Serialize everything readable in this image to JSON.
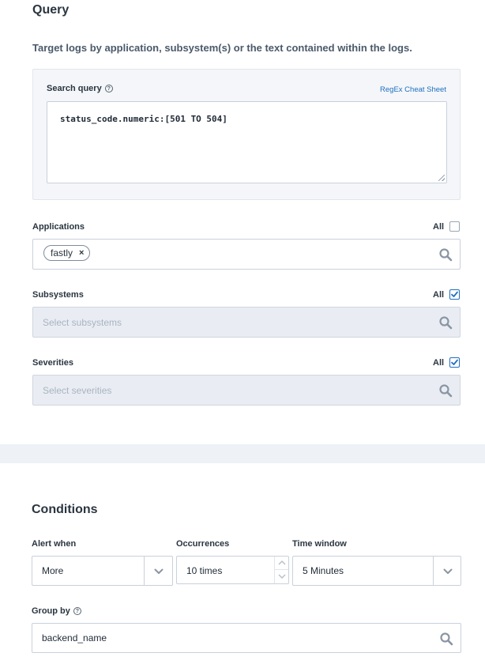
{
  "query": {
    "title": "Query",
    "description": "Target logs by application, subsystem(s) or the text contained within the logs.",
    "search_query_label": "Search query",
    "regex_link": "RegEx Cheat Sheet",
    "search_query_value": "status_code.numeric:[501 TO 504]"
  },
  "applications": {
    "label": "Applications",
    "all_label": "All",
    "all_checked": false,
    "chips": [
      "fastly"
    ],
    "chip_remove": "×"
  },
  "subsystems": {
    "label": "Subsystems",
    "all_label": "All",
    "all_checked": true,
    "placeholder": "Select subsystems"
  },
  "severities": {
    "label": "Severities",
    "all_label": "All",
    "all_checked": true,
    "placeholder": "Select severities"
  },
  "conditions": {
    "title": "Conditions",
    "alert_when_label": "Alert when",
    "alert_when_value": "More",
    "occurrences_label": "Occurrences",
    "occurrences_value": "10 times",
    "time_window_label": "Time window",
    "time_window_value": "5 Minutes",
    "group_by_label": "Group by",
    "group_by_value": "backend_name"
  },
  "colors": {
    "accent": "#1f6fbf",
    "panel_bg": "#f4f6f9",
    "disabled_bg": "#e9edf3"
  },
  "icons": {
    "search": "search-icon",
    "help": "question-circle-icon",
    "checkbox": "checkbox-icon",
    "chevron": "chevron-down-icon"
  }
}
